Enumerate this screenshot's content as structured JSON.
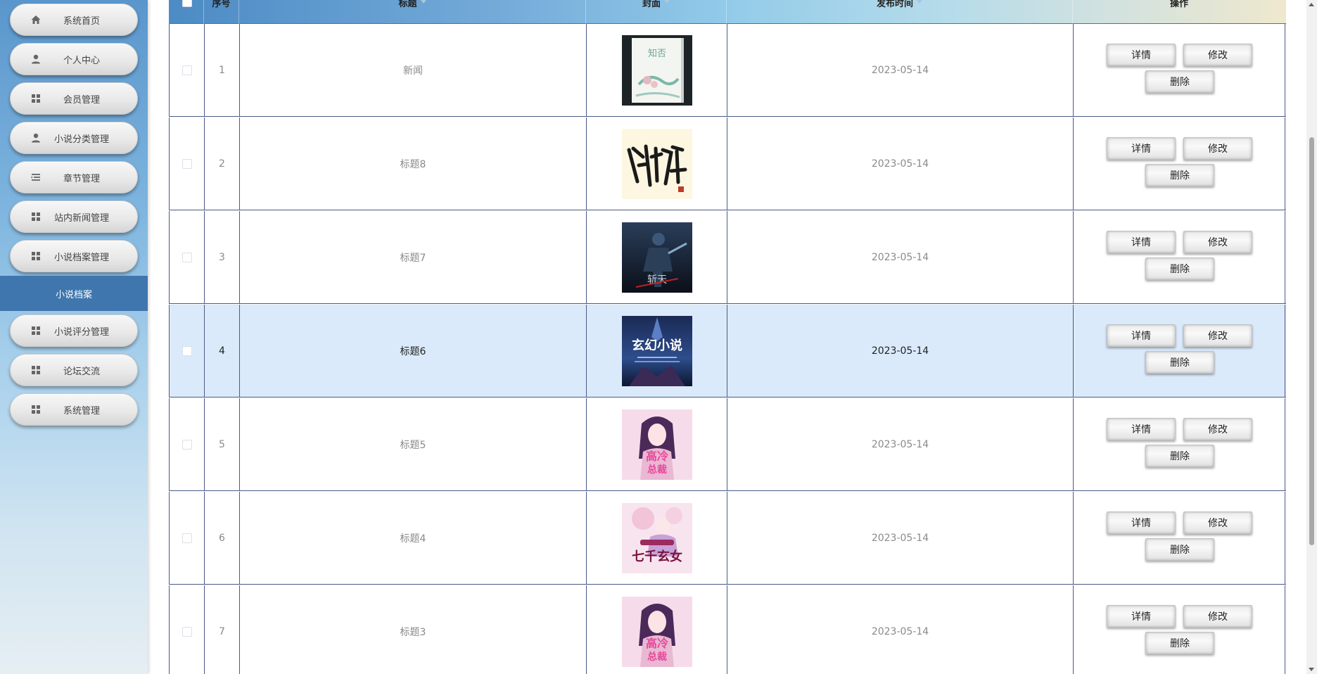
{
  "sidebar": {
    "items": [
      {
        "label": "系统首页",
        "icon": "home-icon"
      },
      {
        "label": "个人中心",
        "icon": "user-icon"
      },
      {
        "label": "会员管理",
        "icon": "grid-icon"
      },
      {
        "label": "小说分类管理",
        "icon": "user-icon"
      },
      {
        "label": "章节管理",
        "icon": "list-icon"
      },
      {
        "label": "站内新闻管理",
        "icon": "grid-icon"
      },
      {
        "label": "小说档案管理",
        "icon": "grid-icon"
      },
      {
        "label": "小说评分管理",
        "icon": "grid-icon"
      },
      {
        "label": "论坛交流",
        "icon": "grid-icon"
      },
      {
        "label": "系统管理",
        "icon": "grid-icon"
      }
    ],
    "active_sub": "小说档案"
  },
  "table": {
    "columns": {
      "index": "序号",
      "title": "标题",
      "cover": "封面",
      "date": "发布时间",
      "actions": "操作"
    },
    "actions": {
      "detail": "详情",
      "edit": "修改",
      "delete": "删除"
    },
    "highlight_row": 4,
    "rows": [
      {
        "index": "1",
        "title": "新闻",
        "date": "2023-05-14",
        "cover": "cover-ink-lotus"
      },
      {
        "index": "2",
        "title": "标题8",
        "date": "2023-05-14",
        "cover": "cover-calligraphy"
      },
      {
        "index": "3",
        "title": "标题7",
        "date": "2023-05-14",
        "cover": "cover-scifi-soldier"
      },
      {
        "index": "4",
        "title": "标题6",
        "date": "2023-05-14",
        "cover": "cover-fantasy"
      },
      {
        "index": "5",
        "title": "标题5",
        "date": "2023-05-14",
        "cover": "cover-pink-girl"
      },
      {
        "index": "6",
        "title": "标题4",
        "date": "2023-05-14",
        "cover": "cover-pink-xuannv"
      },
      {
        "index": "7",
        "title": "标题3",
        "date": "2023-05-14",
        "cover": "cover-pink-girl"
      }
    ]
  },
  "colors": {
    "sidebar_active": "#3f76ad",
    "row_border": "#4a5a86",
    "row_highlight": "#daeafb"
  }
}
